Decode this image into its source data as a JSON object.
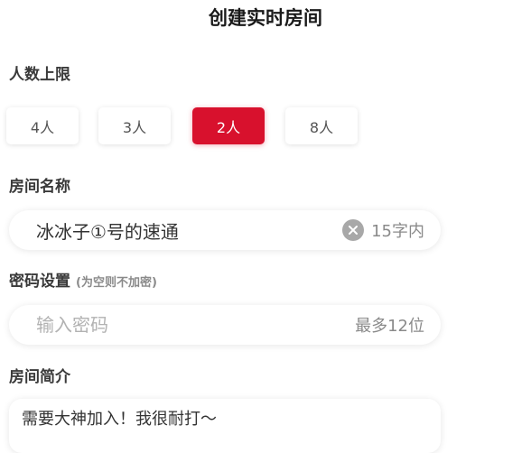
{
  "header": {
    "title": "创建实时房间"
  },
  "capacity": {
    "label": "人数上限",
    "options": [
      {
        "label": "4人",
        "selected": false
      },
      {
        "label": "3人",
        "selected": false
      },
      {
        "label": "2人",
        "selected": true
      },
      {
        "label": "8人",
        "selected": false
      }
    ]
  },
  "room_name": {
    "label": "房间名称",
    "value": "冰冰子①号的速通",
    "limit_text": "15字内"
  },
  "password": {
    "label": "密码设置",
    "hint": "(为空则不加密)",
    "placeholder": "输入密码",
    "limit_text": "最多12位"
  },
  "intro": {
    "label": "房间简介",
    "value": "需要大神加入！我很耐打～"
  },
  "colors": {
    "accent": "#d8112d",
    "background": "#ffffff",
    "muted_text": "#8a8a8a"
  },
  "icons": {
    "clear": "clear-icon"
  }
}
